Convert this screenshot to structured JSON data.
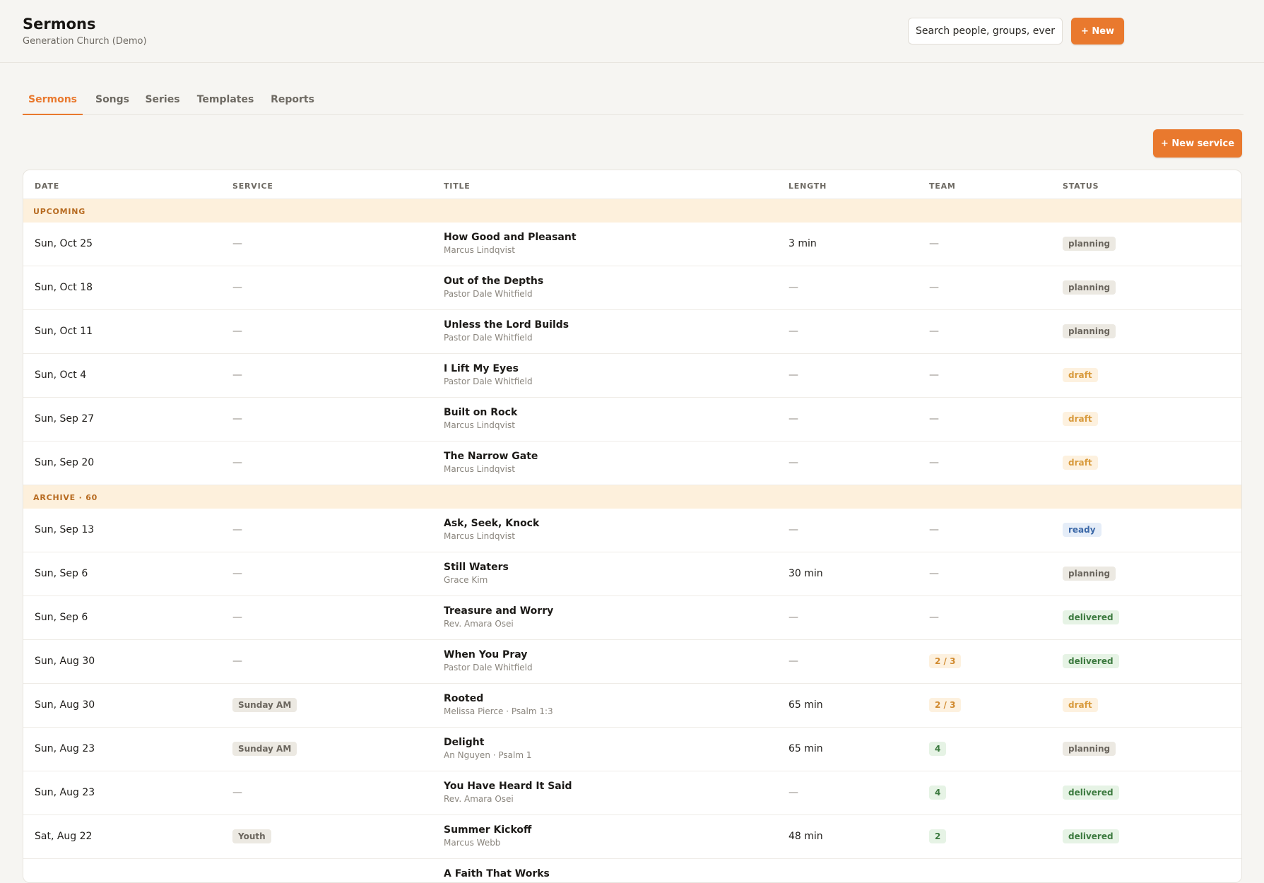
{
  "header": {
    "title": "Sermons",
    "org": "Generation Church (Demo)",
    "search_placeholder": "Search people, groups, ever",
    "new_label": "+ New"
  },
  "tabs": [
    "Sermons",
    "Songs",
    "Series",
    "Templates",
    "Reports"
  ],
  "active_tab": "Sermons",
  "new_service_label": "+ New service",
  "table": {
    "columns": [
      "DATE",
      "SERVICE",
      "TITLE",
      "LENGTH",
      "TEAM",
      "STATUS"
    ],
    "sections": {
      "upcoming": "UPCOMING",
      "archive": "ARCHIVE · 60"
    },
    "upcoming_rows": [
      {
        "date": "Sun, Oct 25",
        "service": "—",
        "title": "How Good and Pleasant",
        "subtitle": "Marcus Lindqvist",
        "length": "3 min",
        "team": "—",
        "status": "planning"
      },
      {
        "date": "Sun, Oct 18",
        "service": "—",
        "title": "Out of the Depths",
        "subtitle": "Pastor Dale Whitfield",
        "length": "—",
        "team": "—",
        "status": "planning"
      },
      {
        "date": "Sun, Oct 11",
        "service": "—",
        "title": "Unless the Lord Builds",
        "subtitle": "Pastor Dale Whitfield",
        "length": "—",
        "team": "—",
        "status": "planning"
      },
      {
        "date": "Sun, Oct 4",
        "service": "—",
        "title": "I Lift My Eyes",
        "subtitle": "Pastor Dale Whitfield",
        "length": "—",
        "team": "—",
        "status": "draft"
      },
      {
        "date": "Sun, Sep 27",
        "service": "—",
        "title": "Built on Rock",
        "subtitle": "Marcus Lindqvist",
        "length": "—",
        "team": "—",
        "status": "draft"
      },
      {
        "date": "Sun, Sep 20",
        "service": "—",
        "title": "The Narrow Gate",
        "subtitle": "Marcus Lindqvist",
        "length": "—",
        "team": "—",
        "status": "draft"
      }
    ],
    "archive_rows": [
      {
        "date": "Sun, Sep 13",
        "service": "—",
        "title": "Ask, Seek, Knock",
        "subtitle": "Marcus Lindqvist",
        "length": "—",
        "team": "—",
        "status": "ready"
      },
      {
        "date": "Sun, Sep 6",
        "service": "—",
        "title": "Still Waters",
        "subtitle": "Grace Kim",
        "length": "30 min",
        "team": "—",
        "status": "planning"
      },
      {
        "date": "Sun, Sep 6",
        "service": "—",
        "title": "Treasure and Worry",
        "subtitle": "Rev. Amara Osei",
        "length": "—",
        "team": "—",
        "status": "delivered"
      },
      {
        "date": "Sun, Aug 30",
        "service": "—",
        "title": "When You Pray",
        "subtitle": "Pastor Dale Whitfield",
        "length": "—",
        "team": "2 / 3",
        "team_state": "partial",
        "status": "delivered"
      },
      {
        "date": "Sun, Aug 30",
        "service": "Sunday AM",
        "title": "Rooted",
        "subtitle": "Melissa Pierce · Psalm 1:3",
        "length": "65 min",
        "team": "2 / 3",
        "team_state": "partial",
        "status": "draft"
      },
      {
        "date": "Sun, Aug 23",
        "service": "Sunday AM",
        "title": "Delight",
        "subtitle": "An Nguyen · Psalm 1",
        "length": "65 min",
        "team": "4",
        "team_state": "full",
        "status": "planning"
      },
      {
        "date": "Sun, Aug 23",
        "service": "—",
        "title": "You Have Heard It Said",
        "subtitle": "Rev. Amara Osei",
        "length": "—",
        "team": "4",
        "team_state": "full",
        "status": "delivered"
      },
      {
        "date": "Sat, Aug 22",
        "service": "Youth",
        "title": "Summer Kickoff",
        "subtitle": "Marcus Webb",
        "length": "48 min",
        "team": "2",
        "team_state": "full",
        "status": "delivered"
      },
      {
        "date": "",
        "service": "",
        "title": "A Faith That Works",
        "subtitle": "",
        "length": "",
        "team": "",
        "status": ""
      }
    ]
  },
  "colors": {
    "accent": "#e9792e",
    "section_bg": "#fdf0dc",
    "status_planning": "#ece9e2",
    "status_draft": "#fdf1df",
    "status_ready": "#e5edf8",
    "status_delivered": "#e6f3e5"
  }
}
